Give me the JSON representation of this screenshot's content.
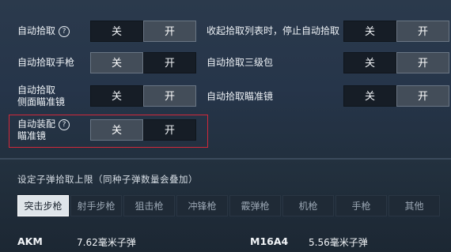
{
  "settings": {
    "auto_pickup": {
      "label": "自动拾取",
      "off": "关",
      "on": "开",
      "selected": "on"
    },
    "stop_on_list_collapse": {
      "label": "收起拾取列表时，停止自动拾取",
      "off": "关",
      "on": "开",
      "selected": "on"
    },
    "auto_pickup_pistol": {
      "label": "自动拾取手枪",
      "off": "关",
      "on": "开",
      "selected": "off"
    },
    "auto_pickup_lvl3_bag": {
      "label": "自动拾取三级包",
      "off": "关",
      "on": "开",
      "selected": "on"
    },
    "auto_pickup_side_scope": {
      "label_line1": "自动拾取",
      "label_line2": "侧面瞄准镜",
      "off": "关",
      "on": "开",
      "selected": "on"
    },
    "auto_pickup_scope": {
      "label": "自动拾取瞄准镜",
      "off": "关",
      "on": "开",
      "selected": "on"
    },
    "auto_equip_scope": {
      "label_line1": "自动装配",
      "label_line2": "瞄准镜",
      "off": "关",
      "on": "开",
      "selected": "off"
    }
  },
  "help_icon_glyph": "?",
  "ammo_section": {
    "title": "设定子弹拾取上限（同种子弹数量会叠加）",
    "tabs": [
      "突击步枪",
      "射手步枪",
      "狙击枪",
      "冲锋枪",
      "霰弹枪",
      "机枪",
      "手枪",
      "其他"
    ],
    "active_tab_index": 0,
    "rows": [
      {
        "gun": "AKM",
        "ammo": "7.62毫米子弹"
      },
      {
        "gun": "M16A4",
        "ammo": "5.56毫米子弹"
      }
    ]
  },
  "colors": {
    "highlight_border": "#d2283a",
    "selected_bg": "#434d59",
    "unselected_bg": "#161d26"
  },
  "icons": {
    "help": "question-circle-icon"
  }
}
